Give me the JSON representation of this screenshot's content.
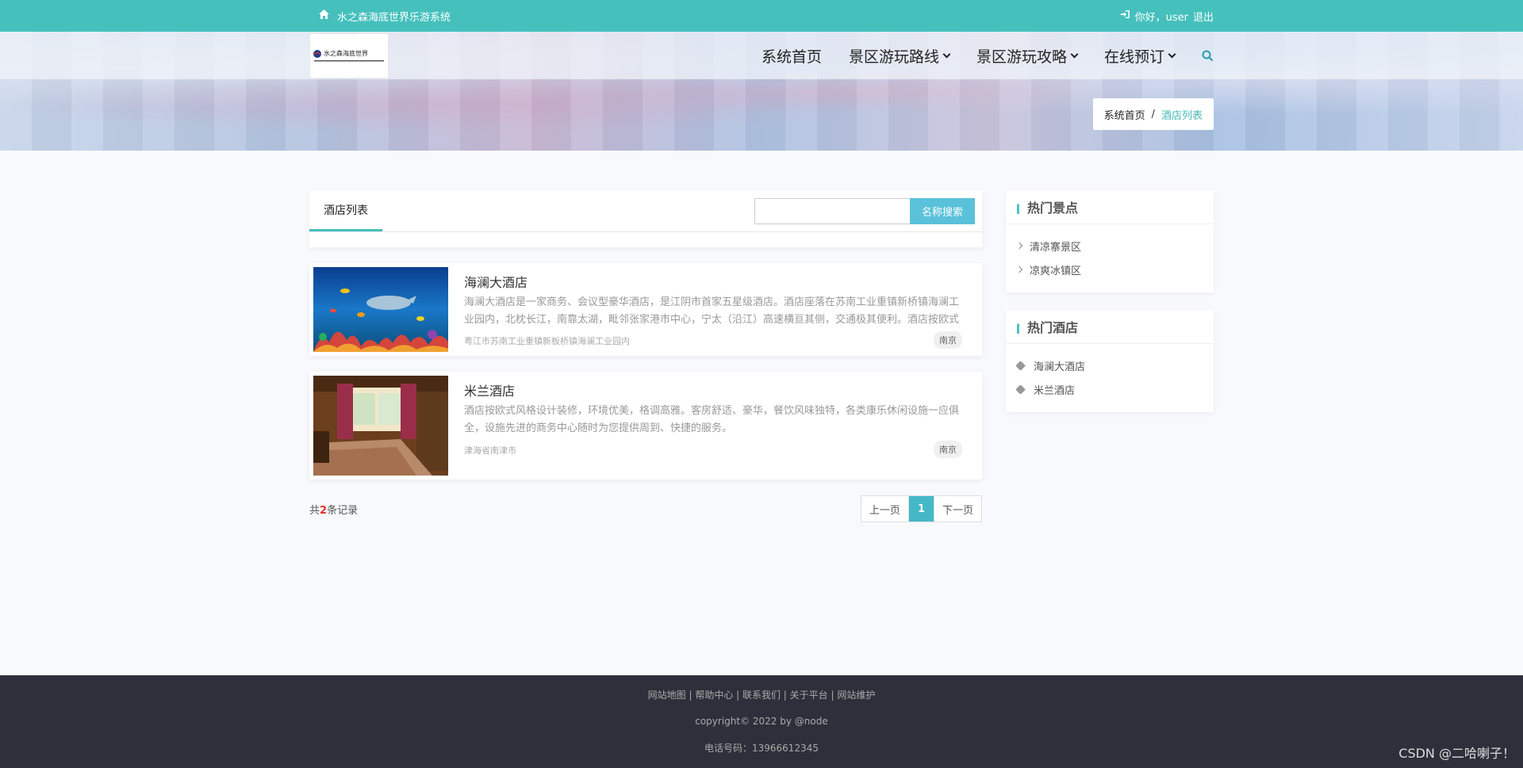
{
  "topbar": {
    "site_name": "水之森海底世界乐游系统",
    "greeting": "你好，user",
    "logout": "退出"
  },
  "nav": {
    "logo_text": "水之森海底世界",
    "items": [
      {
        "label": "系统首页"
      },
      {
        "label": "景区游玩路线"
      },
      {
        "label": "景区游玩攻略"
      },
      {
        "label": "在线预订"
      }
    ]
  },
  "breadcrumb": {
    "home": "系统首页",
    "separator": "/",
    "current": "酒店列表"
  },
  "list": {
    "tab_label": "酒店列表",
    "search_placeholder": "",
    "search_button": "名称搜索",
    "items": [
      {
        "title": "海澜大酒店",
        "desc": "海澜大酒店是一家商务、会议型豪华酒店，是江阴市首家五星级酒店。酒店座落在苏南工业重镇新桥镇海澜工业园内，北枕长江，南靠太湖，毗邻张家港市中心，宁太（沿江）高速横亘其侧，交通极其便利。酒店按欧式",
        "address": "粤江市苏南工业重镇新板桥镇海澜工业园内",
        "tag": "南京"
      },
      {
        "title": "米兰酒店",
        "desc": "酒店按欧式风格设计装修，环境优美，格调高雅。客房舒适、豪华，餐饮风味独特，各类康乐休闲设施一应俱全，设施先进的商务中心随时为您提供周到、快捷的服务。",
        "address": "津海省南津市",
        "tag": "南京"
      }
    ],
    "total_prefix": "共",
    "total_count": "2",
    "total_suffix": "条记录",
    "pager": {
      "prev": "上一页",
      "current": "1",
      "next": "下一页"
    }
  },
  "sidebar": {
    "hot_spots_title": "热门景点",
    "hot_spots": [
      "清凉寨景区",
      "凉爽冰镇区"
    ],
    "hot_hotels_title": "热门酒店",
    "hot_hotels": [
      "海澜大酒店",
      "米兰酒店"
    ]
  },
  "footer": {
    "links": "网站地图 | 帮助中心 | 联系我们 | 关于平台 | 网站维护",
    "copyright": "copyright© 2022 by @node",
    "phone": "电话号码：13966612345"
  },
  "watermark": "CSDN @二哈喇子！",
  "colors": {
    "accent": "#45c0bd",
    "footer_bg": "#2e2f3a",
    "search_button": "#5ac1da"
  }
}
